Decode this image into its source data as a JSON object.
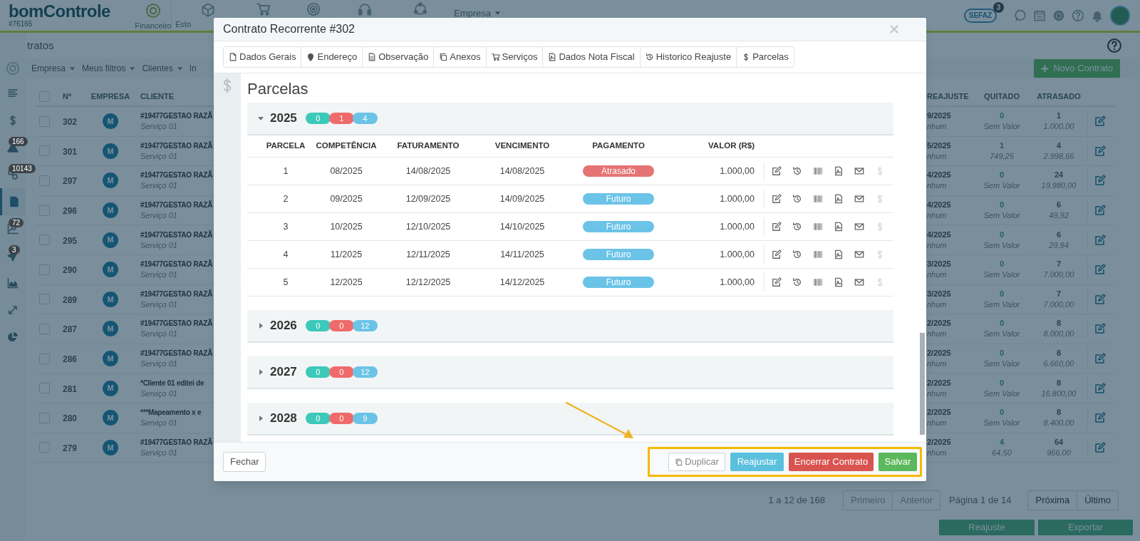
{
  "header": {
    "logo": "bomControle",
    "account": "#76165",
    "nav": [
      {
        "label": "Financeiro"
      },
      {
        "label": "Esto"
      }
    ],
    "company_menu": "Empresa",
    "sefaz": "SEFAZ",
    "sefaz_badge": "3"
  },
  "page": {
    "title": "tratos",
    "filters": [
      "Empresa",
      "Meus filtros",
      "Clientes",
      "In"
    ],
    "new_button": "Novo Contrato"
  },
  "sidebar": {
    "items": [
      {
        "selected": false
      },
      {
        "selected": false
      },
      {
        "selected": false,
        "badge": "166"
      },
      {
        "selected": false,
        "badge": "10143"
      },
      {
        "selected": true
      },
      {
        "selected": false,
        "badge": "72"
      },
      {
        "selected": false,
        "badge": "3"
      },
      {
        "selected": false
      },
      {
        "selected": false
      },
      {
        "selected": false
      }
    ]
  },
  "table": {
    "select_all_checked": false,
    "columns": [
      "Nº",
      "EMPRESA",
      "CLIENTE",
      "REAJUSTE",
      "QUITADO",
      "ATRASADO"
    ],
    "rows": [
      {
        "checked": false,
        "number": "302",
        "company": "M",
        "client": "#19477GESTAO RAZÃ",
        "service": "Serviço 01",
        "reajuste": "9/2025",
        "reajuste_note": "nhum",
        "paid": "0",
        "paid_value": "Sem Valor",
        "late": "1",
        "late_value": "1.000,00"
      },
      {
        "checked": false,
        "number": "301",
        "company": "M",
        "client": "#19477GESTAO RAZÃ",
        "service": "Serviço 01",
        "reajuste": "5/2025",
        "reajuste_note": "nhum",
        "paid": "1",
        "paid_value": "749,25",
        "late": "4",
        "late_value": "2.998,66"
      },
      {
        "checked": false,
        "number": "297",
        "company": "M",
        "client": "#19477GESTAO RAZÃ",
        "service": "Serviço 01",
        "reajuste": "4/2025",
        "reajuste_note": "nhum",
        "paid": "0",
        "paid_value": "Sem Valor",
        "late": "24",
        "late_value": "19.980,00"
      },
      {
        "checked": false,
        "number": "296",
        "company": "M",
        "client": "#19477GESTAO RAZÃ",
        "service": "Serviço 01",
        "reajuste": "4/2025",
        "reajuste_note": "nhum",
        "paid": "0",
        "paid_value": "Sem Valor",
        "late": "6",
        "late_value": "49,92"
      },
      {
        "checked": false,
        "number": "295",
        "company": "M",
        "client": "#19477GESTAO RAZÃ",
        "service": "Serviço 01",
        "reajuste": "4/2025",
        "reajuste_note": "nhum",
        "paid": "0",
        "paid_value": "Sem Valor",
        "late": "6",
        "late_value": "29,94"
      },
      {
        "checked": false,
        "number": "290",
        "company": "M",
        "client": "#19477GESTAO RAZÃ",
        "service": "Serviço 01",
        "reajuste": "3/2025",
        "reajuste_note": "nhum",
        "paid": "0",
        "paid_value": "Sem Valor",
        "late": "7",
        "late_value": "7.000,00"
      },
      {
        "checked": false,
        "number": "289",
        "company": "M",
        "client": "#19477GESTAO RAZÃ",
        "service": "Serviço 01",
        "reajuste": "3/2025",
        "reajuste_note": "nhum",
        "paid": "0",
        "paid_value": "Sem Valor",
        "late": "7",
        "late_value": "7.000,00"
      },
      {
        "checked": false,
        "number": "287",
        "company": "M",
        "client": "#19477GESTAO RAZÃ",
        "service": "Serviço 01",
        "reajuste": "2/2025",
        "reajuste_note": "nhum",
        "paid": "0",
        "paid_value": "Sem Valor",
        "late": "8",
        "late_value": "8.000,00"
      },
      {
        "checked": false,
        "number": "286",
        "company": "M",
        "client": "#19477GESTAO RAZÃ",
        "service": "Serviço 01",
        "reajuste": "2/2025",
        "reajuste_note": "nhum",
        "paid": "0",
        "paid_value": "Sem Valor",
        "late": "8",
        "late_value": "6.660,00"
      },
      {
        "checked": false,
        "number": "281",
        "company": "M",
        "client": "*Cliente 01 editei de",
        "service": "Serviço 01",
        "reajuste": "2/2025",
        "reajuste_note": "nhum",
        "paid": "0",
        "paid_value": "Sem Valor",
        "late": "8",
        "late_value": "16.800,00"
      },
      {
        "checked": false,
        "number": "280",
        "company": "M",
        "client": "***Mapeamento x e",
        "service": "Serviço 01",
        "reajuste": "2/2025",
        "reajuste_note": "nhum",
        "paid": "0",
        "paid_value": "Sem Valor",
        "late": "8",
        "late_value": "8.400,00"
      },
      {
        "checked": false,
        "number": "279",
        "company": "M",
        "client": "#19477GESTAO RAZÃ",
        "service": "Serviço 01",
        "reajuste": "2/2025",
        "reajuste_note": "nhum",
        "paid": "4",
        "paid_value": "64,50",
        "late": "64",
        "late_value": "966,00"
      }
    ]
  },
  "pagination": {
    "summary": "1 a 12 de 168",
    "page": "Página 1 de 14",
    "buttons": [
      {
        "label": "Primeiro",
        "disabled": true
      },
      {
        "label": "Anterior",
        "disabled": true
      },
      {
        "label": "Próxima",
        "disabled": false
      },
      {
        "label": "Último",
        "disabled": false
      }
    ]
  },
  "footer_buttons": [
    "Reajuste",
    "Exportar"
  ],
  "modal": {
    "title": "Contrato Recorrente #302",
    "tabs": [
      "Dados Gerais",
      "Endereço",
      "Observação",
      "Anexos",
      "Serviços",
      "Dados Nota Fiscal",
      "Historico Reajuste",
      "Parcelas"
    ],
    "section": "Parcelas",
    "columns": [
      "PARCELA",
      "COMPETÊNCIA",
      "FATURAMENTO",
      "VENCIMENTO",
      "PAGAMENTO",
      "VALOR (R$)"
    ],
    "years": [
      {
        "year": "2025",
        "expanded": true,
        "counts": [
          "0",
          "1",
          "4"
        ],
        "rows": [
          {
            "parcela": "1",
            "competencia": "08/2025",
            "faturamento": "14/08/2025",
            "vencimento": "14/08/2025",
            "kind": "late",
            "pagamento": "Atrasado",
            "valor": "1.000,00",
            "pay_disabled": true
          },
          {
            "parcela": "2",
            "competencia": "09/2025",
            "faturamento": "12/09/2025",
            "vencimento": "14/09/2025",
            "kind": "future",
            "pagamento": "Futuro",
            "valor": "1.000,00",
            "pay_disabled": true
          },
          {
            "parcela": "3",
            "competencia": "10/2025",
            "faturamento": "12/10/2025",
            "vencimento": "14/10/2025",
            "kind": "future",
            "pagamento": "Futuro",
            "valor": "1.000,00",
            "pay_disabled": true
          },
          {
            "parcela": "4",
            "competencia": "11/2025",
            "faturamento": "12/11/2025",
            "vencimento": "14/11/2025",
            "kind": "future",
            "pagamento": "Futuro",
            "valor": "1.000,00",
            "pay_disabled": true
          },
          {
            "parcela": "5",
            "competencia": "12/2025",
            "faturamento": "12/12/2025",
            "vencimento": "14/12/2025",
            "kind": "future",
            "pagamento": "Futuro",
            "valor": "1.000,00",
            "pay_disabled": true
          }
        ]
      },
      {
        "year": "2026",
        "expanded": false,
        "counts": [
          "0",
          "0",
          "12"
        ]
      },
      {
        "year": "2027",
        "expanded": false,
        "counts": [
          "0",
          "0",
          "12"
        ]
      },
      {
        "year": "2028",
        "expanded": false,
        "counts": [
          "0",
          "0",
          "9"
        ]
      }
    ],
    "buttons": {
      "close": "Fechar",
      "duplicate": "Duplicar",
      "adjust": "Reajustar",
      "end": "Encerrar Contrato",
      "save": "Salvar"
    }
  }
}
